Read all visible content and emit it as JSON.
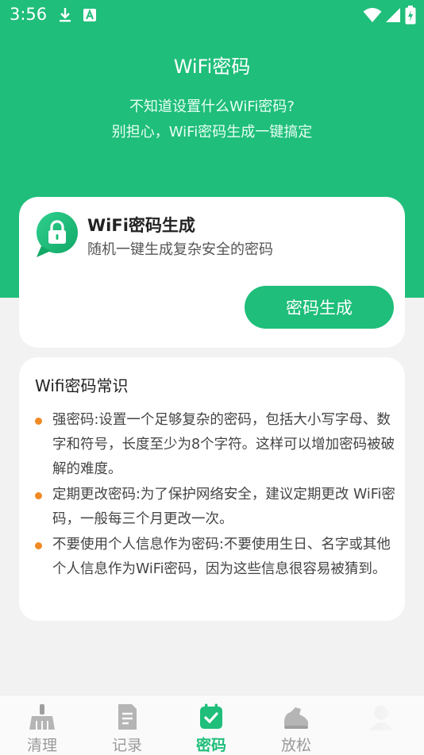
{
  "status_bar": {
    "time": "3:56"
  },
  "header": {
    "title": "WiFi密码",
    "subtitle_line1": "不知道设置什么WiFi密码?",
    "subtitle_line2": "别担心，WiFi密码生成一键搞定"
  },
  "generator_card": {
    "title": "WiFi密码生成",
    "description": "随机一键生成复杂安全的密码",
    "button_label": "密码生成",
    "icon": "lock-chat-icon"
  },
  "tips_card": {
    "title": "Wifi密码常识",
    "items": [
      {
        "text": "强密码:设置一个足够复杂的密码，包括大小写字母、数字和符号，长度至少为8个字符。这样可以增加密码被破解的难度。"
      },
      {
        "text": "定期更改密码:为了保护网络安全，建议定期更改 WiFi密码，一般每三个月更改一次。"
      },
      {
        "text": "不要使用个人信息作为密码:不要使用生日、名字或其他个人信息作为WiFi密码，因为这些信息很容易被猜到。"
      }
    ]
  },
  "bottom_nav": {
    "items": [
      {
        "label": "清理",
        "icon": "broom-icon"
      },
      {
        "label": "记录",
        "icon": "document-icon"
      },
      {
        "label": "密码",
        "icon": "calendar-check-icon",
        "active": true
      },
      {
        "label": "放松",
        "icon": "sneaker-icon"
      },
      {
        "label": "",
        "icon": "avatar-icon"
      }
    ]
  },
  "colors": {
    "brand_green": "#1fbe7a",
    "bullet_orange": "#f08a24",
    "background": "#f2f2f2"
  }
}
